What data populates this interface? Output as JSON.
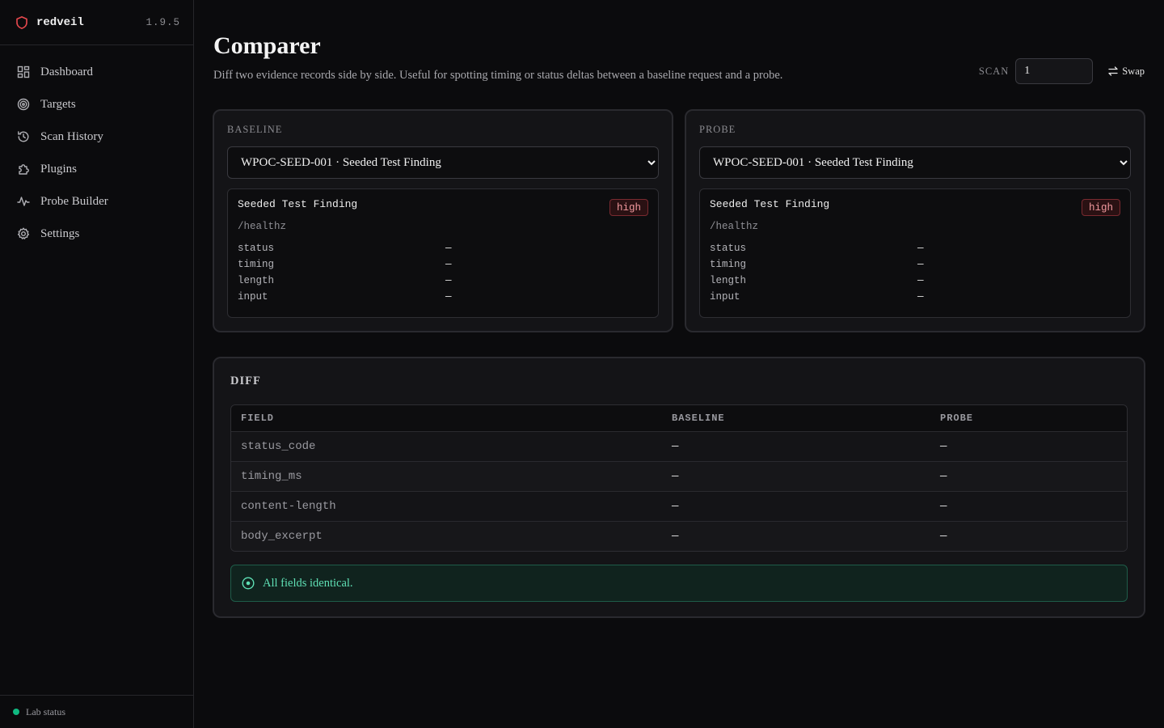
{
  "app": {
    "name": "redveil",
    "version": "1.9.5",
    "brand_color": "#e5484d"
  },
  "sidebar": {
    "items": [
      {
        "label": "Dashboard",
        "icon": "dashboard-icon"
      },
      {
        "label": "Targets",
        "icon": "target-icon"
      },
      {
        "label": "Scan History",
        "icon": "history-icon"
      },
      {
        "label": "Plugins",
        "icon": "puzzle-icon"
      },
      {
        "label": "Probe Builder",
        "icon": "waveform-icon"
      },
      {
        "label": "Settings",
        "icon": "gear-icon"
      }
    ],
    "footer": {
      "label": "Lab status",
      "status_color": "#10b981"
    }
  },
  "header": {
    "title": "Comparer",
    "description": "Diff two evidence records side by side. Useful for spotting timing or status deltas between a baseline request and a probe.",
    "scan_label": "SCAN",
    "scan_value": "1",
    "swap_label": "Swap"
  },
  "baseline": {
    "label": "BASELINE",
    "selected": "WPOC-SEED-001 · Seeded Test Finding",
    "record": {
      "title": "Seeded Test Finding",
      "severity": "high",
      "path": "/healthz",
      "fields": [
        {
          "key": "status",
          "value": "—"
        },
        {
          "key": "timing",
          "value": "—"
        },
        {
          "key": "length",
          "value": "—"
        },
        {
          "key": "input",
          "value": "—"
        }
      ]
    }
  },
  "probe": {
    "label": "PROBE",
    "selected": "WPOC-SEED-001 · Seeded Test Finding",
    "record": {
      "title": "Seeded Test Finding",
      "severity": "high",
      "path": "/healthz",
      "fields": [
        {
          "key": "status",
          "value": "—"
        },
        {
          "key": "timing",
          "value": "—"
        },
        {
          "key": "length",
          "value": "—"
        },
        {
          "key": "input",
          "value": "—"
        }
      ]
    }
  },
  "diff": {
    "title": "DIFF",
    "columns": [
      "FIELD",
      "BASELINE",
      "PROBE"
    ],
    "rows": [
      {
        "field": "status_code",
        "baseline": "—",
        "probe": "—"
      },
      {
        "field": "timing_ms",
        "baseline": "—",
        "probe": "—"
      },
      {
        "field": "content-length",
        "baseline": "—",
        "probe": "—"
      },
      {
        "field": "body_excerpt",
        "baseline": "—",
        "probe": "—"
      }
    ],
    "notice": "All fields identical.",
    "notice_icon": "check-circle-icon"
  }
}
